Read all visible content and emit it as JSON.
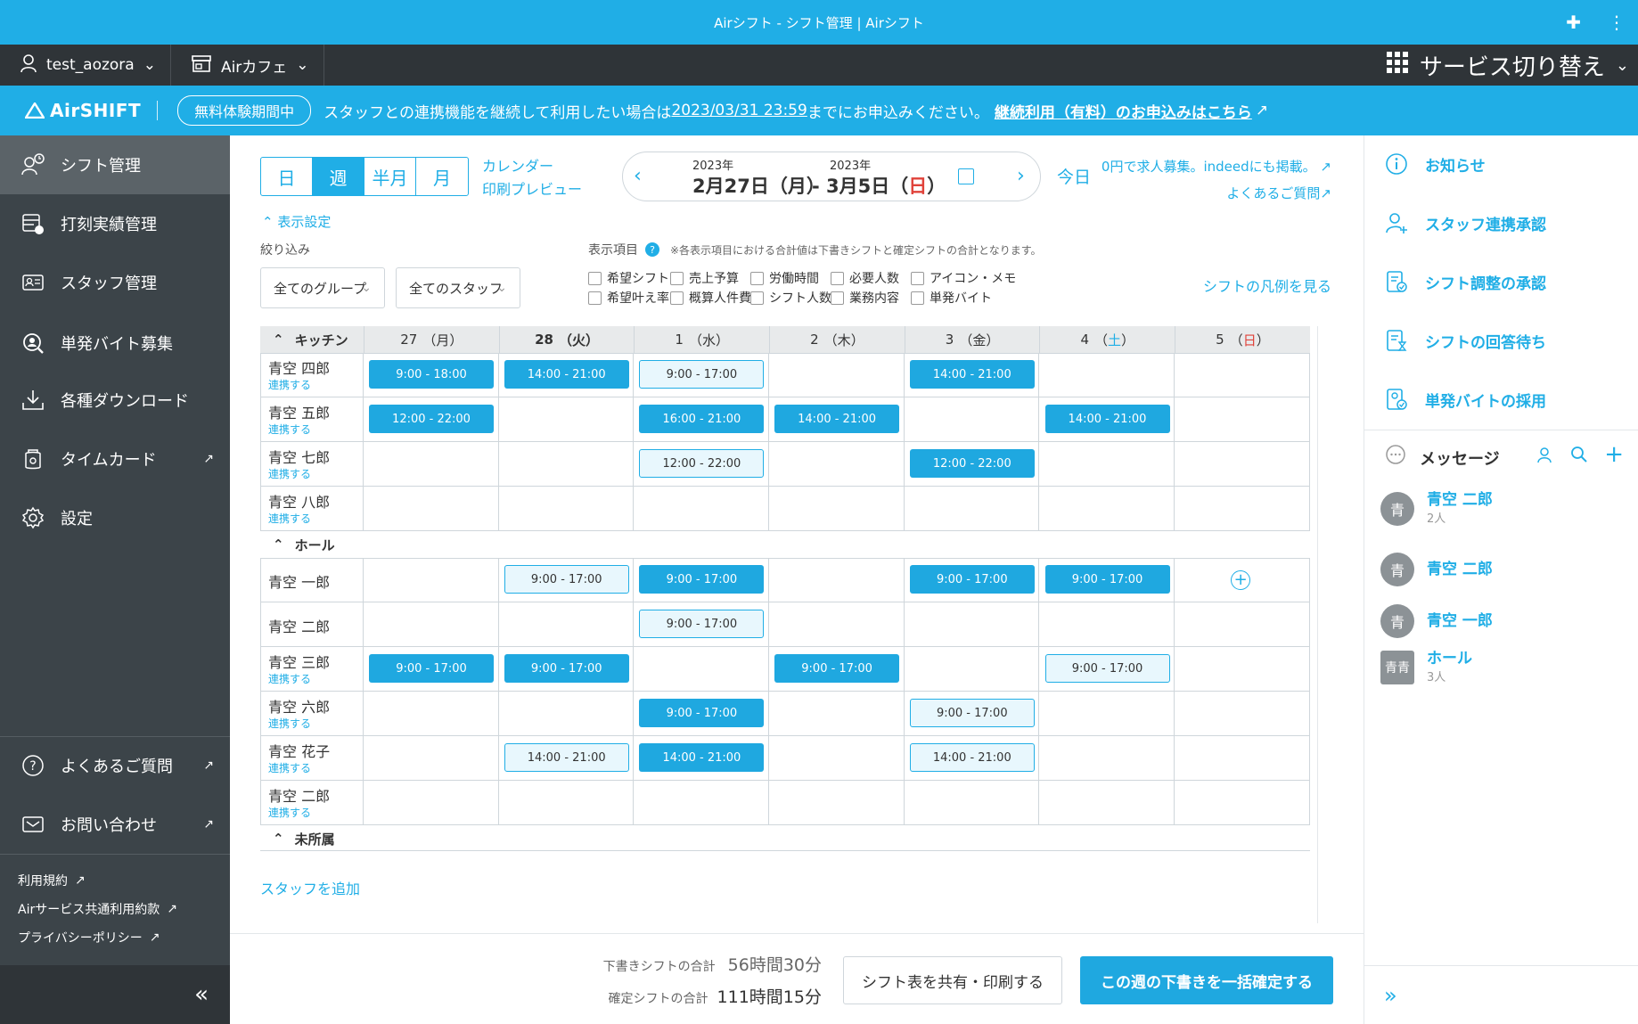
{
  "window": {
    "title": "Airシフト - シフト管理 | Airシフト"
  },
  "topbar": {
    "user": "test_aozora",
    "store": "Airカフェ",
    "service_switch": "サービス切り替え"
  },
  "notice": {
    "logo": "AirSHIFT",
    "trial": "無料体験期間中",
    "text_before": "スタッフとの連携機能を継続して利用したい場合は",
    "deadline": "2023/03/31 23:59",
    "text_after": "までにお申込みください。",
    "cta": "継続利用（有料）のお申込みはこちら"
  },
  "sidebar": {
    "items": [
      {
        "label": "シフト管理"
      },
      {
        "label": "打刻実績管理"
      },
      {
        "label": "スタッフ管理"
      },
      {
        "label": "単発バイト募集"
      },
      {
        "label": "各種ダウンロード"
      },
      {
        "label": "タイムカード"
      },
      {
        "label": "設定"
      }
    ],
    "help": "よくあるご質問",
    "contact": "お問い合わせ",
    "legal": [
      "利用規約",
      "Airサービス共通利用約款",
      "プライバシーポリシー"
    ],
    "collapse": "«"
  },
  "toolbar": {
    "views": [
      "日",
      "週",
      "半月",
      "月"
    ],
    "calendar_preview_1": "カレンダー",
    "calendar_preview_2": "印刷プレビュー",
    "start_year": "2023年",
    "start_date": "2月27日（月）",
    "end_year": "2023年",
    "end_date_prefix": "- 3月5日（",
    "end_date_day": "日",
    "end_date_suffix": "）",
    "today": "今日",
    "promo": "0円で求人募集。indeedにも掲載。",
    "faq": "よくあるご質問"
  },
  "filters": {
    "display_settings": "表示設定",
    "narrow": "絞り込み",
    "group": "全てのグループ",
    "staff": "全てのスタッフ",
    "items_label": "表示項目",
    "items_note": "※各表示項目における合計値は下書きシフトと確定シフトの合計となります。",
    "checkboxes": [
      "希望シフト",
      "売上予算",
      "労働時間",
      "必要人数",
      "アイコン・メモ",
      "希望叶え率",
      "概算人件費",
      "シフト人数",
      "業務内容",
      "単発バイト"
    ],
    "legend": "シフトの凡例を見る"
  },
  "grid": {
    "days": [
      {
        "num": "27",
        "pre": "（",
        "dow": "月",
        "post": "）"
      },
      {
        "num": "28",
        "pre": "（",
        "dow": "火",
        "post": "）"
      },
      {
        "num": "1",
        "pre": "（",
        "dow": "水",
        "post": "）"
      },
      {
        "num": "2",
        "pre": "（",
        "dow": "木",
        "post": "）"
      },
      {
        "num": "3",
        "pre": "（",
        "dow": "金",
        "post": "）"
      },
      {
        "num": "4",
        "pre": "（",
        "dow": "土",
        "post": "）"
      },
      {
        "num": "5",
        "pre": "（",
        "dow": "日",
        "post": "）"
      }
    ],
    "link_label": "連携する",
    "sections": [
      {
        "name": "キッチン",
        "rows": [
          {
            "name": "青空 四郎",
            "link": true,
            "shifts": [
              [
                "9:00 - 18:00",
                "c"
              ],
              [
                "14:00 - 21:00",
                "c"
              ],
              [
                "9:00 - 17:00",
                "d"
              ],
              null,
              [
                "14:00 - 21:00",
                "c"
              ],
              null,
              null
            ]
          },
          {
            "name": "青空 五郎",
            "link": true,
            "shifts": [
              [
                "12:00 - 22:00",
                "c"
              ],
              null,
              [
                "16:00 - 21:00",
                "c"
              ],
              [
                "14:00 - 21:00",
                "c"
              ],
              null,
              [
                "14:00 - 21:00",
                "c"
              ],
              null
            ]
          },
          {
            "name": "青空 七郎",
            "link": true,
            "shifts": [
              null,
              null,
              [
                "12:00 - 22:00",
                "d"
              ],
              null,
              [
                "12:00 - 22:00",
                "c"
              ],
              null,
              null
            ]
          },
          {
            "name": "青空 八郎",
            "link": true,
            "shifts": [
              null,
              null,
              null,
              null,
              null,
              null,
              null
            ]
          }
        ]
      },
      {
        "name": "ホール",
        "rows": [
          {
            "name": "青空 一郎",
            "link": false,
            "shifts": [
              null,
              [
                "9:00 - 17:00",
                "d"
              ],
              [
                "9:00 - 17:00",
                "c"
              ],
              null,
              [
                "9:00 - 17:00",
                "c"
              ],
              [
                "9:00 - 17:00",
                "c"
              ],
              "add"
            ]
          },
          {
            "name": "青空 二郎",
            "link": false,
            "shifts": [
              null,
              null,
              [
                "9:00 - 17:00",
                "d"
              ],
              null,
              null,
              null,
              null
            ]
          },
          {
            "name": "青空 三郎",
            "link": true,
            "shifts": [
              [
                "9:00 - 17:00",
                "c"
              ],
              [
                "9:00 - 17:00",
                "c"
              ],
              null,
              [
                "9:00 - 17:00",
                "c"
              ],
              null,
              [
                "9:00 - 17:00",
                "d"
              ],
              null
            ]
          },
          {
            "name": "青空 六郎",
            "link": true,
            "shifts": [
              null,
              null,
              [
                "9:00 - 17:00",
                "c"
              ],
              null,
              [
                "9:00 - 17:00",
                "d"
              ],
              null,
              null
            ]
          },
          {
            "name": "青空 花子",
            "link": true,
            "shifts": [
              null,
              [
                "14:00 - 21:00",
                "d"
              ],
              [
                "14:00 - 21:00",
                "c"
              ],
              null,
              [
                "14:00 - 21:00",
                "d"
              ],
              null,
              null
            ]
          },
          {
            "name": "青空 二郎",
            "link": true,
            "shifts": [
              null,
              null,
              null,
              null,
              null,
              null,
              null
            ]
          }
        ]
      },
      {
        "name": "未所属",
        "rows": []
      }
    ],
    "add_staff": "スタッフを追加"
  },
  "footer": {
    "draft_label": "下書きシフトの合計",
    "draft_value": "56時間30分",
    "confirmed_label": "確定シフトの合計",
    "confirmed_value": "111時間15分",
    "share": "シフト表を共有・印刷する",
    "confirm": "この週の下書きを一括確定する"
  },
  "rpanel": {
    "items": [
      {
        "label": "お知らせ",
        "icon": "info-icon"
      },
      {
        "label": "スタッフ連携承認",
        "icon": "user-add-icon"
      },
      {
        "label": "シフト調整の承認",
        "icon": "doc-check-icon"
      },
      {
        "label": "シフトの回答待ち",
        "icon": "doc-hourglass-icon"
      },
      {
        "label": "単発バイトの採用",
        "icon": "doc-user-icon"
      }
    ],
    "messages_title": "メッセージ",
    "messages": [
      {
        "avatar": "青",
        "name": "青空 二郎",
        "count": "2人"
      },
      {
        "avatar": "青",
        "name": "青空 二郎",
        "count": ""
      },
      {
        "avatar": "青",
        "name": "青空 一郎",
        "count": ""
      },
      {
        "avatar": "青青",
        "name": "ホール",
        "count": "3人"
      }
    ],
    "expand": "»"
  },
  "colors": {
    "accent": "#20aee6",
    "dark": "#2f3438",
    "sidebar": "#3c4449",
    "confirmed": "#1fa8e0",
    "draft_bg": "#e8f7fd",
    "sunday": "#e0423a"
  }
}
